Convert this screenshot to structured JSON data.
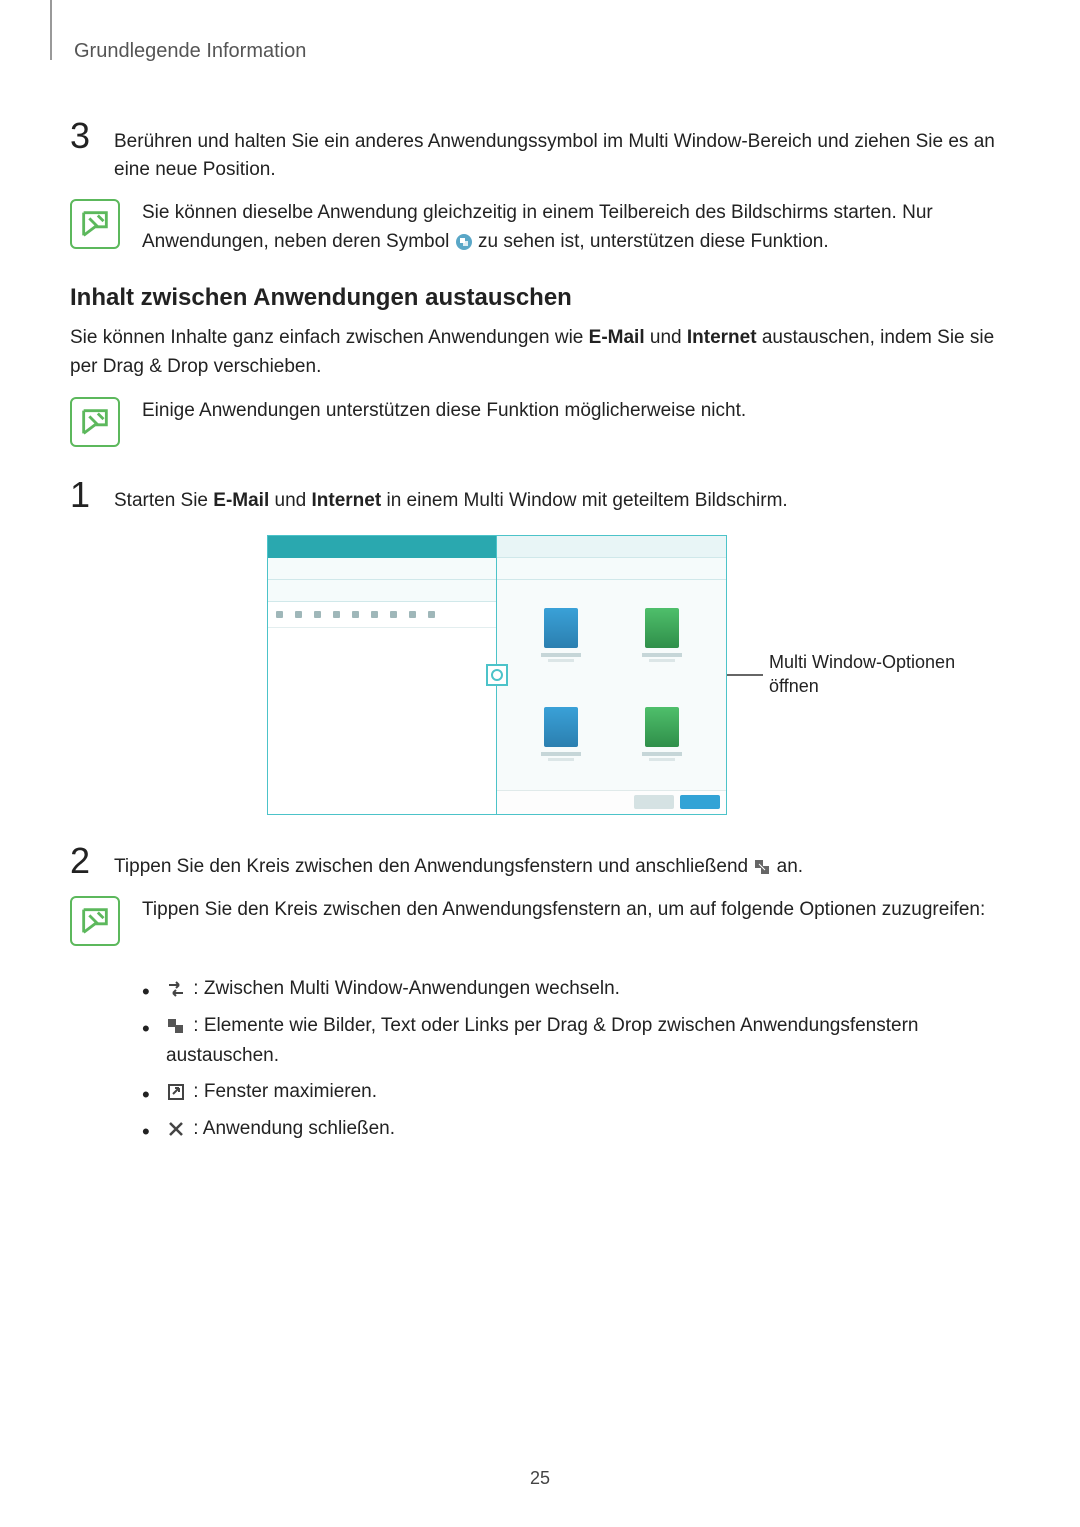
{
  "header": {
    "title": "Grundlegende Information"
  },
  "step3": {
    "num": "3",
    "text": "Berühren und halten Sie ein anderes Anwendungssymbol im Multi Window-Bereich und ziehen Sie es an eine neue Position."
  },
  "note1": {
    "pre": "Sie können dieselbe Anwendung gleichzeitig in einem Teilbereich des Bildschirms starten. Nur Anwendungen, neben deren Symbol ",
    "post": " zu sehen ist, unterstützen diese Funktion."
  },
  "subheading": "Inhalt zwischen Anwendungen austauschen",
  "intro": {
    "pre": "Sie können Inhalte ganz einfach zwischen Anwendungen wie ",
    "b1": "E-Mail",
    "mid": " und ",
    "b2": "Internet",
    "post": " austauschen, indem Sie sie per Drag & Drop verschieben."
  },
  "note2": {
    "text": "Einige Anwendungen unterstützen diese Funktion möglicherweise nicht."
  },
  "step1": {
    "num": "1",
    "pre": "Starten Sie ",
    "b1": "E-Mail",
    "mid": " und ",
    "b2": "Internet",
    "post": " in einem Multi Window mit geteiltem Bildschirm."
  },
  "callout": {
    "text": "Multi Window-Optionen öffnen"
  },
  "step2": {
    "num": "2",
    "pre": "Tippen Sie den Kreis zwischen den Anwendungsfenstern und anschließend ",
    "post": " an."
  },
  "note3": {
    "text": "Tippen Sie den Kreis zwischen den Anwendungsfenstern an, um auf folgende Optionen zuzugreifen:"
  },
  "bullets": {
    "b1": " : Zwischen Multi Window-Anwendungen wechseln.",
    "b2": " : Elemente wie Bilder, Text oder Links per Drag & Drop zwischen Anwendungsfenstern austauschen.",
    "b3": " : Fenster maximieren.",
    "b4": " : Anwendung schließen."
  },
  "page_number": "25"
}
